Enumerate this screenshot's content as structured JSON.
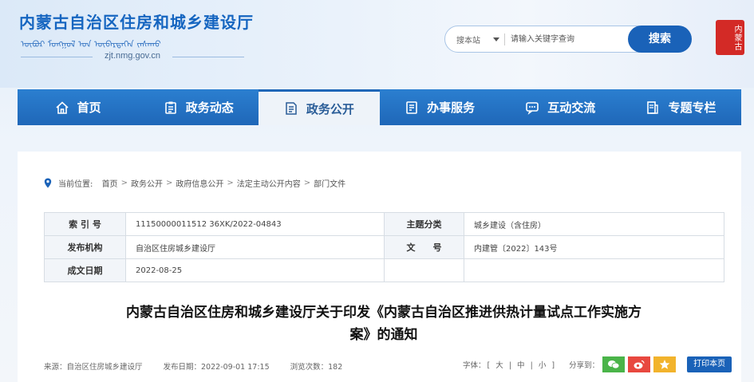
{
  "header": {
    "title": "内蒙古自治区住房和城乡建设厅",
    "mongolian": "ᠥᠪᠦᠷ ᠮᠣᠩᠭᠣᠯ ᠤᠨ ᠥᠪᠡᠷᠲᠡᠭᠡᠨ ᠵᠠᠰᠠᠬᠤ",
    "domain": "zjt.nmg.gov.cn",
    "seal_text": "内蒙古"
  },
  "search": {
    "scope": "搜本站",
    "placeholder": "请输入关键字查询",
    "button": "搜索"
  },
  "nav": {
    "items": [
      {
        "label": "首页",
        "icon": "home-icon"
      },
      {
        "label": "政务动态",
        "icon": "clipboard-icon"
      },
      {
        "label": "政务公开",
        "icon": "document-icon"
      },
      {
        "label": "办事服务",
        "icon": "service-icon"
      },
      {
        "label": "互动交流",
        "icon": "chat-icon"
      },
      {
        "label": "专题专栏",
        "icon": "column-icon"
      }
    ],
    "active_index": 2
  },
  "breadcrumb": {
    "prefix": "当前位置:",
    "items": [
      "首页",
      "政务公开",
      "政府信息公开",
      "法定主动公开内容",
      "部门文件"
    ]
  },
  "meta": {
    "index_label": "索 引 号",
    "index_value": "11150000011512 36XK/2022-04843",
    "category_label": "主题分类",
    "category_value": "城乡建设（含住房）",
    "publisher_label": "发布机构",
    "publisher_value": "自治区住房城乡建设厅",
    "docno_label": "文　　号",
    "docno_value": "内建管〔2022〕143号",
    "date_label": "成文日期",
    "date_value": "2022-08-25"
  },
  "doc": {
    "title_line1": "内蒙古自治区住房和城乡建设厅关于印发《内蒙古自治区推进供热计量试点工作实施方",
    "title_line2": "案》的通知"
  },
  "info": {
    "source": "来源：自治区住房城乡建设厅",
    "publish": "发布日期：2022-09-01 17:15",
    "views": "浏览次数：182"
  },
  "tools": {
    "font_label": "字体：",
    "font_large": "大",
    "font_medium": "中",
    "font_small": "小",
    "share_label": "分享到：",
    "print": "打印本页",
    "colors": {
      "wechat": "#4ab449",
      "weibo": "#e8483f",
      "favorite": "#f2b32c"
    }
  }
}
